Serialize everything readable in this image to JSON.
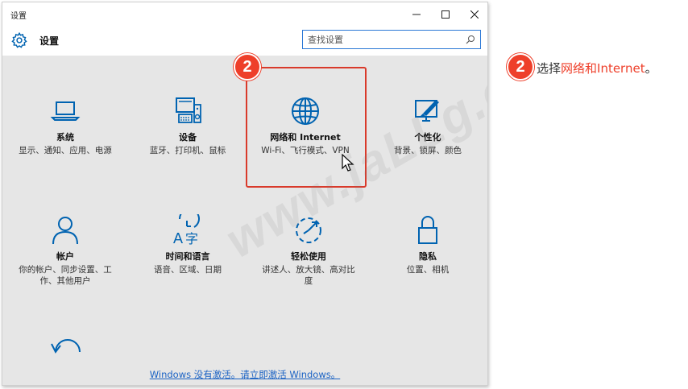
{
  "window": {
    "title": "设置",
    "app_name": "设置",
    "search_placeholder": "查找设置"
  },
  "tiles": [
    {
      "name": "系统",
      "desc": "显示、通知、应用、电源",
      "icon": "laptop-icon"
    },
    {
      "name": "设备",
      "desc": "蓝牙、打印机、鼠标",
      "icon": "devices-icon"
    },
    {
      "name": "网络和 Internet",
      "desc": "Wi-Fi、飞行模式、VPN",
      "icon": "globe-icon"
    },
    {
      "name": "个性化",
      "desc": "背景、锁屏、颜色",
      "icon": "personalization-icon"
    },
    {
      "name": "帐户",
      "desc": "你的帐户、同步设置、工作、其他用户",
      "icon": "person-icon"
    },
    {
      "name": "时间和语言",
      "desc": "语音、区域、日期",
      "icon": "time-language-icon"
    },
    {
      "name": "轻松使用",
      "desc": "讲述人、放大镜、高对比度",
      "icon": "ease-of-access-icon"
    },
    {
      "name": "隐私",
      "desc": "位置、相机",
      "icon": "lock-icon"
    }
  ],
  "activation_link": "Windows 没有激活。请立即激活 Windows。",
  "step_badge": "2",
  "instruction": {
    "prefix": "选择",
    "highlight": "网络和Internet",
    "suffix": "。"
  },
  "watermark": "www.jaLLg.com",
  "colors": {
    "accent": "#0063b1",
    "highlight_red": "#ee3f2a",
    "link": "#1a62c4"
  }
}
